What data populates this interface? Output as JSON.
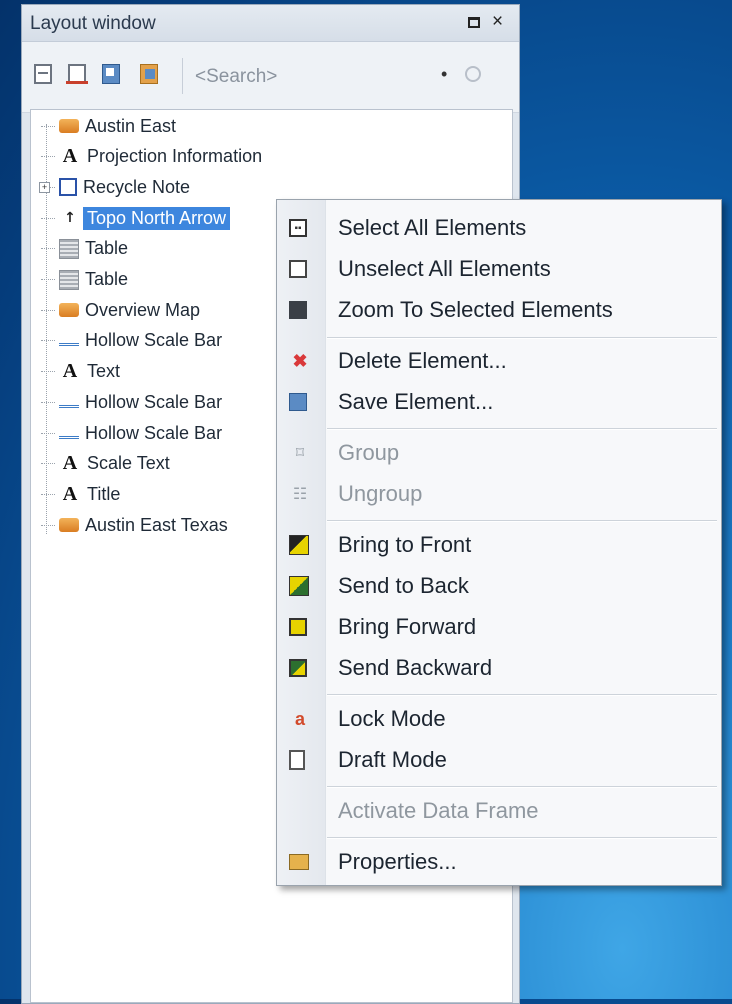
{
  "window": {
    "title": "Layout window",
    "restore_glyph": "",
    "close_glyph": "×"
  },
  "toolbar": {
    "search_placeholder": "<Search>",
    "dropdown_glyph": "•"
  },
  "tree": {
    "items": [
      {
        "label": "Austin East",
        "icon": "map-frame-icon"
      },
      {
        "label": "Projection Information",
        "icon": "text-icon",
        "glyph": "A"
      },
      {
        "label": "Recycle Note",
        "icon": "group-icon",
        "expander": "+"
      },
      {
        "label": "Topo North Arrow",
        "icon": "north-arrow-icon",
        "glyph": "↑",
        "selected": true
      },
      {
        "label": "Table",
        "icon": "table-icon"
      },
      {
        "label": "Table",
        "icon": "table-icon"
      },
      {
        "label": "Overview Map",
        "icon": "map-frame-icon"
      },
      {
        "label": "Hollow Scale Bar",
        "icon": "scale-bar-icon"
      },
      {
        "label": "Text",
        "icon": "text-icon",
        "glyph": "A"
      },
      {
        "label": "Hollow Scale Bar",
        "icon": "scale-bar-icon"
      },
      {
        "label": "Hollow Scale Bar",
        "icon": "scale-bar-icon"
      },
      {
        "label": "Scale Text",
        "icon": "text-icon",
        "glyph": "A"
      },
      {
        "label": "Title",
        "icon": "text-icon",
        "glyph": "A"
      },
      {
        "label": "Austin East Texas",
        "icon": "map-frame-icon"
      }
    ]
  },
  "context_menu": {
    "items": [
      {
        "label": "Select All Elements",
        "icon": "select-all-icon",
        "enabled": true
      },
      {
        "label": "Unselect All Elements",
        "icon": "unselect-all-icon",
        "enabled": true
      },
      {
        "label": "Zoom To Selected Elements",
        "icon": "zoom-selected-icon",
        "enabled": true
      },
      {
        "label": "Delete Element...",
        "icon": "delete-icon",
        "glyph": "✖",
        "enabled": true
      },
      {
        "label": "Save Element...",
        "icon": "save-element-icon",
        "enabled": true
      },
      {
        "label": "Group",
        "icon": "group-icon",
        "glyph": "⌑",
        "enabled": false
      },
      {
        "label": "Ungroup",
        "icon": "ungroup-icon",
        "glyph": "☷",
        "enabled": false
      },
      {
        "label": "Bring to Front",
        "icon": "bring-to-front-icon",
        "enabled": true
      },
      {
        "label": "Send to Back",
        "icon": "send-to-back-icon",
        "enabled": true
      },
      {
        "label": "Bring Forward",
        "icon": "bring-forward-icon",
        "enabled": true
      },
      {
        "label": "Send Backward",
        "icon": "send-backward-icon",
        "enabled": true
      },
      {
        "label": "Lock Mode",
        "icon": "lock-icon",
        "glyph": "a",
        "enabled": true
      },
      {
        "label": "Draft Mode",
        "icon": "draft-icon",
        "enabled": true
      },
      {
        "label": "Activate Data Frame",
        "icon": "",
        "enabled": false
      },
      {
        "label": "Properties...",
        "icon": "properties-icon",
        "enabled": true
      }
    ]
  }
}
